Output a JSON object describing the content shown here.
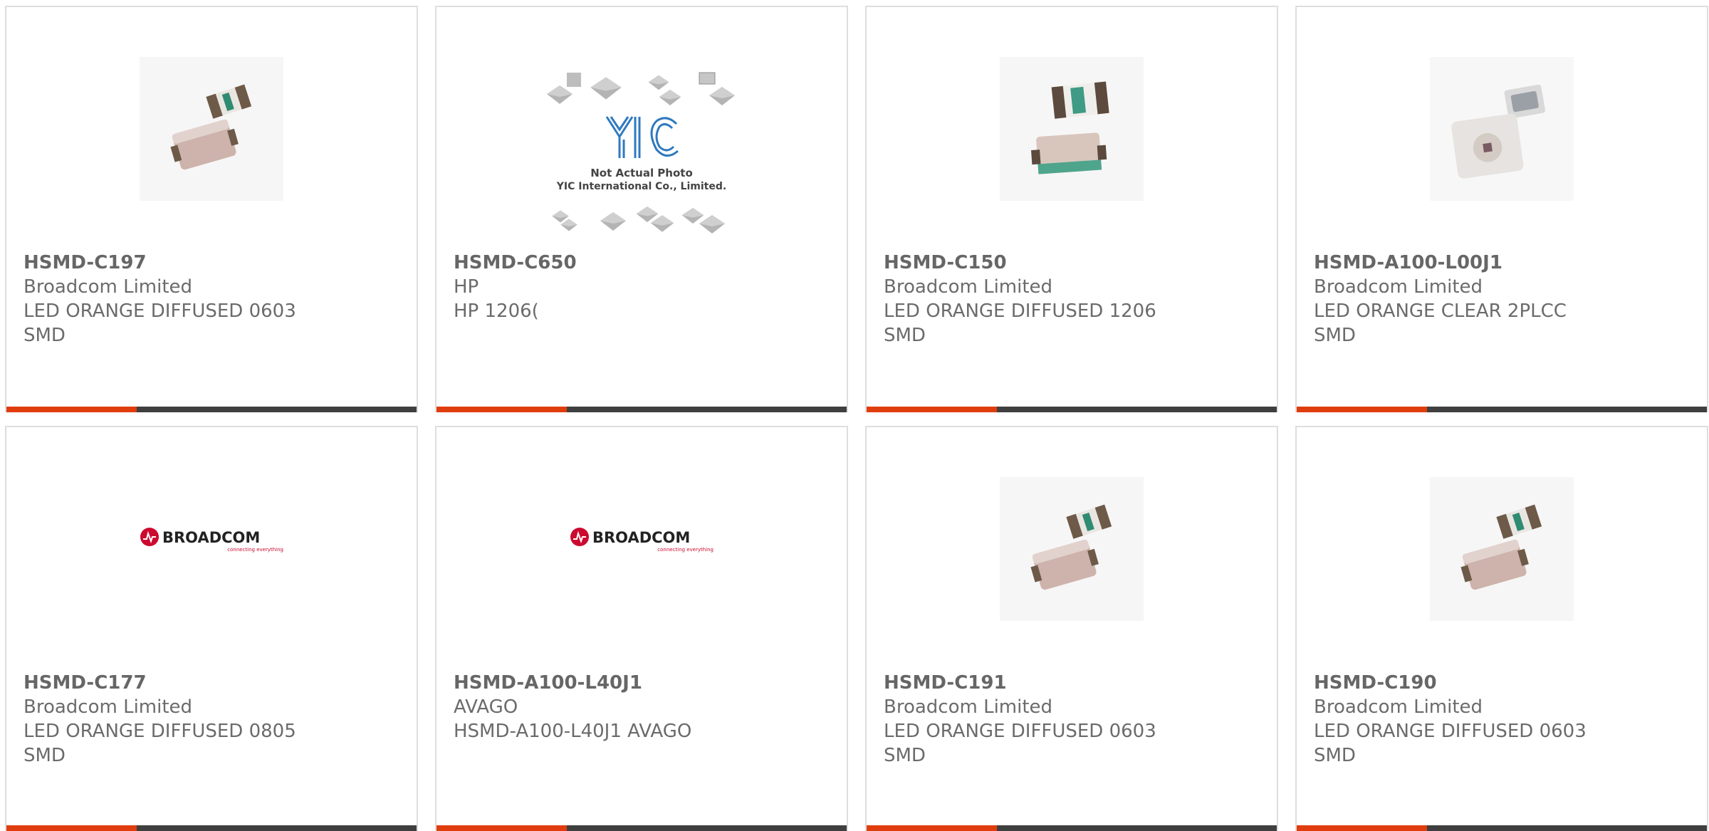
{
  "colors": {
    "accent": "#e03d0e",
    "bar": "#3f3f3f",
    "border": "#dedede",
    "text": "#6b6b6b",
    "broadcom_red": "#cc092f"
  },
  "products": [
    {
      "part": "HSMD-C197",
      "manufacturer": "Broadcom Limited",
      "description": "LED ORANGE DIFFUSED 0603 SMD",
      "image": "led-chip-pair-small"
    },
    {
      "part": "HSMD-C650",
      "manufacturer": "HP",
      "description": "HP 1206(",
      "image": "yic-not-actual-photo",
      "image_text": {
        "logo": "YIC",
        "line1": "Not Actual Photo",
        "line2": "YIC International Co., Limited."
      }
    },
    {
      "part": "HSMD-C150",
      "manufacturer": "Broadcom Limited",
      "description": "LED ORANGE DIFFUSED 1206 SMD",
      "image": "led-chip-pair-large"
    },
    {
      "part": "HSMD-A100-L00J1",
      "manufacturer": "Broadcom Limited",
      "description": "LED ORANGE CLEAR 2PLCC SMD",
      "image": "led-plcc-pair"
    },
    {
      "part": "HSMD-C177",
      "manufacturer": "Broadcom Limited",
      "description": "LED ORANGE DIFFUSED 0805 SMD",
      "image": "broadcom-logo",
      "image_text": {
        "brand": "BROADCOM",
        "tagline": "connecting everything"
      }
    },
    {
      "part": "HSMD-A100-L40J1",
      "manufacturer": "AVAGO",
      "description": "HSMD-A100-L40J1 AVAGO",
      "image": "broadcom-logo",
      "image_text": {
        "brand": "BROADCOM",
        "tagline": "connecting everything"
      }
    },
    {
      "part": "HSMD-C191",
      "manufacturer": "Broadcom Limited",
      "description": "LED ORANGE DIFFUSED 0603 SMD",
      "image": "led-chip-pair-small"
    },
    {
      "part": "HSMD-C190",
      "manufacturer": "Broadcom Limited",
      "description": "LED ORANGE DIFFUSED 0603 SMD",
      "image": "led-chip-pair-small"
    }
  ]
}
